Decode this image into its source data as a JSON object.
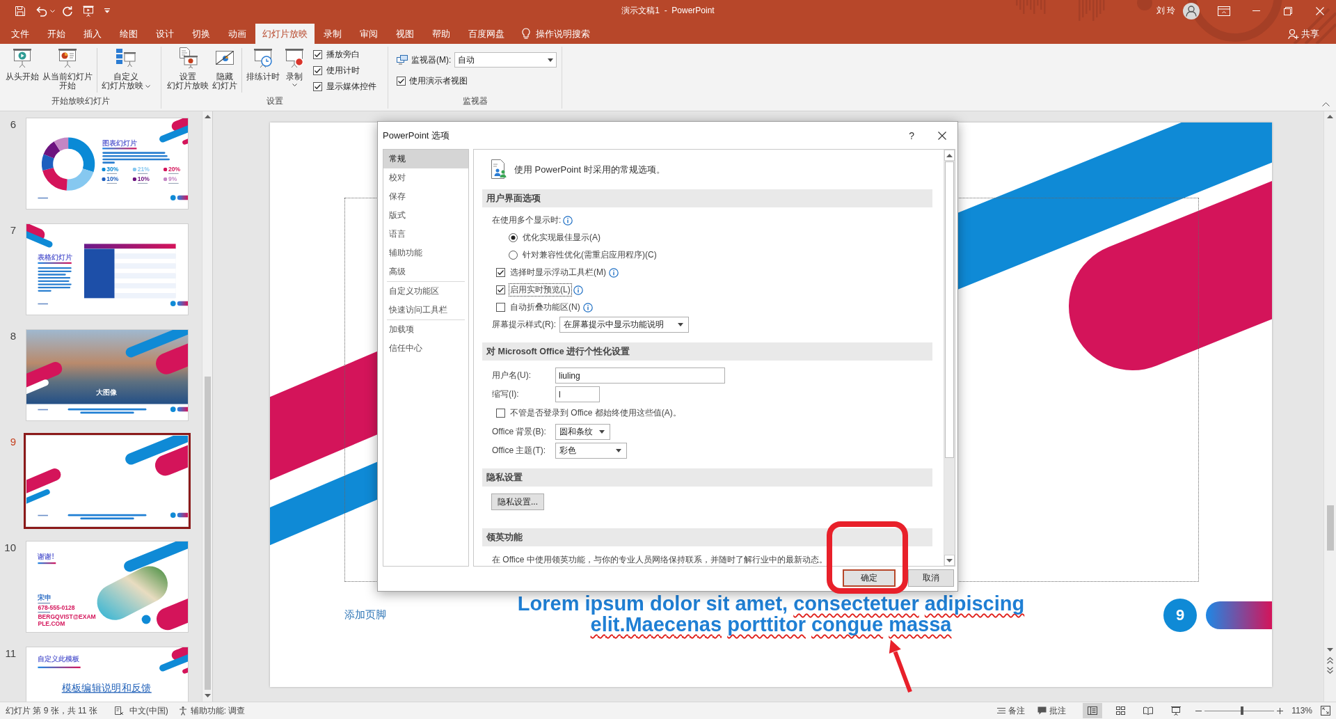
{
  "title_bar": {
    "title": "演示文稿1  -  PowerPoint",
    "user_name": "刘 玲"
  },
  "ribbon_tabs": [
    {
      "label": "文件",
      "selected": false
    },
    {
      "label": "开始",
      "selected": false
    },
    {
      "label": "插入",
      "selected": false
    },
    {
      "label": "绘图",
      "selected": false
    },
    {
      "label": "设计",
      "selected": false
    },
    {
      "label": "切换",
      "selected": false
    },
    {
      "label": "动画",
      "selected": false
    },
    {
      "label": "幻灯片放映",
      "selected": true
    },
    {
      "label": "录制",
      "selected": false
    },
    {
      "label": "审阅",
      "selected": false
    },
    {
      "label": "视图",
      "selected": false
    },
    {
      "label": "帮助",
      "selected": false
    },
    {
      "label": "百度网盘",
      "selected": false
    }
  ],
  "tell_me": "操作说明搜索",
  "share": "共享",
  "ribbon": {
    "groups": [
      {
        "label": "开始放映幻灯片",
        "items": [
          {
            "kind": "large",
            "lines": [
              "从头开始"
            ]
          },
          {
            "kind": "large",
            "lines": [
              "从当前幻灯片",
              "开始"
            ]
          },
          {
            "kind": "large",
            "lines": [
              "自定义",
              "幻灯片放映"
            ],
            "dropdown": true,
            "separator_before": true
          }
        ]
      },
      {
        "label": "设置",
        "items": [
          {
            "kind": "large",
            "lines": [
              "设置",
              "幻灯片放映"
            ]
          },
          {
            "kind": "large",
            "lines": [
              "隐藏",
              "幻灯片"
            ]
          },
          {
            "kind": "large",
            "lines": [
              "排练计时"
            ],
            "separator_before": true
          },
          {
            "kind": "large",
            "lines": [
              "录制"
            ],
            "dropdown": true
          },
          {
            "kind": "checks",
            "checks": [
              {
                "label": "播放旁白",
                "checked": true
              },
              {
                "label": "使用计时",
                "checked": true
              },
              {
                "label": "显示媒体控件",
                "checked": true
              }
            ]
          }
        ]
      },
      {
        "label": "监视器",
        "items": [
          {
            "kind": "monitor",
            "label": "监视器(M):",
            "value": "自动",
            "check": {
              "label": "使用演示者视图",
              "checked": true
            }
          }
        ]
      }
    ]
  },
  "slides_panel": {
    "slides": [
      {
        "number": "6",
        "kind": "chart",
        "selected": false,
        "title": "图表幻灯片",
        "chart_data": {
          "type": "donut",
          "categories": [
            "30%",
            "21%",
            "20%",
            "10%",
            "10%",
            "9%"
          ],
          "values": [
            30,
            21,
            20,
            10,
            10,
            9
          ]
        }
      },
      {
        "number": "7",
        "kind": "table",
        "selected": false,
        "title": "表格幻灯片"
      },
      {
        "number": "8",
        "kind": "image",
        "selected": false,
        "title": "大图像"
      },
      {
        "number": "9",
        "kind": "blank",
        "selected": true
      },
      {
        "number": "10",
        "kind": "contact",
        "selected": false,
        "title": "谢谢!",
        "name": "宋申",
        "phone": "678-555-0128",
        "email": "BERGQVIST@EXAMPLE.COM"
      },
      {
        "number": "11",
        "kind": "custom",
        "selected": false,
        "title": "自定义此模板",
        "link": "模板编辑说明和反馈"
      }
    ]
  },
  "editor_slide": {
    "footer": "添加页脚",
    "body": [
      {
        "text": "Lorem ipsum dolor sit amet,",
        "misspelled": false
      },
      {
        "text": "consectetuer",
        "misspelled": true
      },
      {
        "text": "adipiscing",
        "misspelled": true
      },
      {
        "text": "elit.Maecenas",
        "misspelled": true
      },
      {
        "text": "porttitor",
        "misspelled": true
      },
      {
        "text": "congue",
        "misspelled": true
      },
      {
        "text": "massa",
        "misspelled": true
      }
    ],
    "page_number": "9"
  },
  "dialog": {
    "title": "PowerPoint 选项",
    "help": "?",
    "nav": [
      {
        "label": "常规",
        "selected": true
      },
      {
        "label": "校对",
        "selected": false
      },
      {
        "label": "保存",
        "selected": false
      },
      {
        "label": "版式",
        "selected": false
      },
      {
        "label": "语言",
        "selected": false
      },
      {
        "label": "辅助功能",
        "selected": false
      },
      {
        "label": "高级",
        "selected": false,
        "separator_after": true
      },
      {
        "label": "自定义功能区",
        "selected": false
      },
      {
        "label": "快速访问工具栏",
        "selected": false,
        "separator_after": true
      },
      {
        "label": "加载项",
        "selected": false
      },
      {
        "label": "信任中心",
        "selected": false
      }
    ],
    "heading": "使用 PowerPoint 时采用的常规选项。",
    "sections": [
      {
        "title": "用户界面选项",
        "rows": [
          {
            "kind": "label",
            "text": "在使用多个显示时:",
            "info": true
          },
          {
            "kind": "radio",
            "text": "优化实现最佳显示(A)",
            "selected": true
          },
          {
            "kind": "radio",
            "text": "针对兼容性优化(需重启应用程序)(C)",
            "selected": false
          },
          {
            "kind": "checkbox",
            "text": "选择时显示浮动工具栏(M)",
            "checked": true,
            "focused": false,
            "info": true
          },
          {
            "kind": "checkbox",
            "text": "启用实时预览(L)",
            "checked": true,
            "focused": true,
            "info": true
          },
          {
            "kind": "checkbox",
            "text": "自动折叠功能区(N)",
            "checked": false,
            "focused": false,
            "info": true
          },
          {
            "kind": "select",
            "label": "屏幕提示样式(R):",
            "value": "在屏幕提示中显示功能说明"
          }
        ]
      },
      {
        "title": "对 Microsoft Office 进行个性化设置",
        "rows": [
          {
            "kind": "input",
            "label": "用户名(U):",
            "value": "liuling"
          },
          {
            "kind": "input",
            "label": "缩写(I):",
            "value": "l"
          },
          {
            "kind": "checkbox",
            "text": "不管是否登录到 Office 都始终使用这些值(A)。",
            "checked": false,
            "focused": false,
            "info": false
          },
          {
            "kind": "select",
            "label": "Office 背景(B):",
            "value": "圆和条纹"
          },
          {
            "kind": "select",
            "label": "Office 主题(T):",
            "value": "彩色"
          }
        ]
      },
      {
        "title": "隐私设置",
        "rows": [
          {
            "kind": "button",
            "text": "隐私设置..."
          }
        ]
      },
      {
        "title": "领英功能",
        "rows": [
          {
            "kind": "text",
            "text": "在 Office 中使用领英功能，与你的专业人员网络保持联系，并随时了解行业中的最新动态。"
          }
        ]
      }
    ],
    "buttons": [
      {
        "label": "确定",
        "default": true
      },
      {
        "label": "取消",
        "default": false
      }
    ]
  },
  "status_bar": {
    "slide_info": "幻灯片 第 9 张，共 11 张",
    "language": "中文(中国)",
    "accessibility": "辅助功能: 调查",
    "notes": "备注",
    "comments": "批注",
    "views": [
      {
        "selected": true
      },
      {
        "selected": false
      },
      {
        "selected": false
      },
      {
        "selected": false
      }
    ],
    "zoom": {
      "level": 0.54,
      "reading": "113%"
    }
  },
  "annotations": {
    "highlight_box": true,
    "pointer_arrow": true
  }
}
